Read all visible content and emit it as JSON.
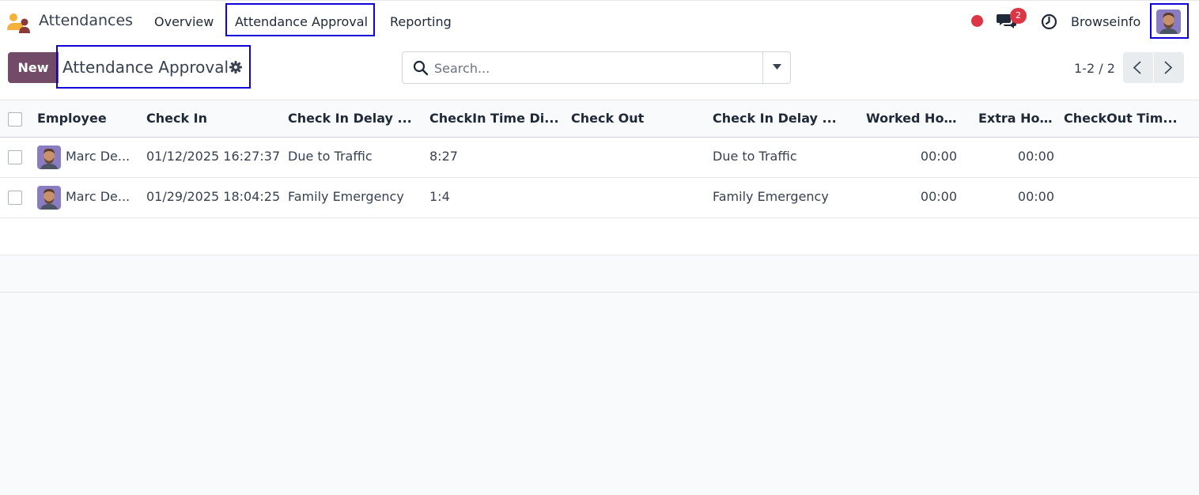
{
  "navbar": {
    "app_name": "Attendances",
    "menu": {
      "overview": "Overview",
      "approval": "Attendance Approval",
      "reporting": "Reporting"
    },
    "message_count": "2",
    "company": "Browseinfo"
  },
  "control": {
    "new_label": "New",
    "title": "Attendance Approval",
    "search_placeholder": "Search...",
    "pager": "1-2 / 2"
  },
  "table": {
    "headers": {
      "employee": "Employee",
      "check_in": "Check In",
      "check_in_delay": "Check In Delay ...",
      "checkin_time_diff": "CheckIn Time Di...",
      "check_out": "Check Out",
      "check_in_delay_2": "Check In Delay ...",
      "worked_hours": "Worked Ho...",
      "extra_hours": "Extra Hours",
      "checkout_time": "CheckOut Tim..."
    },
    "rows": [
      {
        "employee": "Marc De...",
        "check_in": "01/12/2025 16:27:37",
        "check_in_delay": "Due to Traffic",
        "checkin_time_diff": "8:27",
        "check_out": "",
        "check_in_delay_2": "Due to Traffic",
        "worked_hours": "00:00",
        "extra_hours": "00:00",
        "checkout_time": ""
      },
      {
        "employee": "Marc De...",
        "check_in": "01/29/2025 18:04:25",
        "check_in_delay": "Family Emergency",
        "checkin_time_diff": "1:4",
        "check_out": "",
        "check_in_delay_2": "Family Emergency",
        "worked_hours": "00:00",
        "extra_hours": "00:00",
        "checkout_time": ""
      }
    ]
  },
  "colors": {
    "brand": "#714b67",
    "highlight": "#1200d8",
    "badge": "#dc3545"
  }
}
